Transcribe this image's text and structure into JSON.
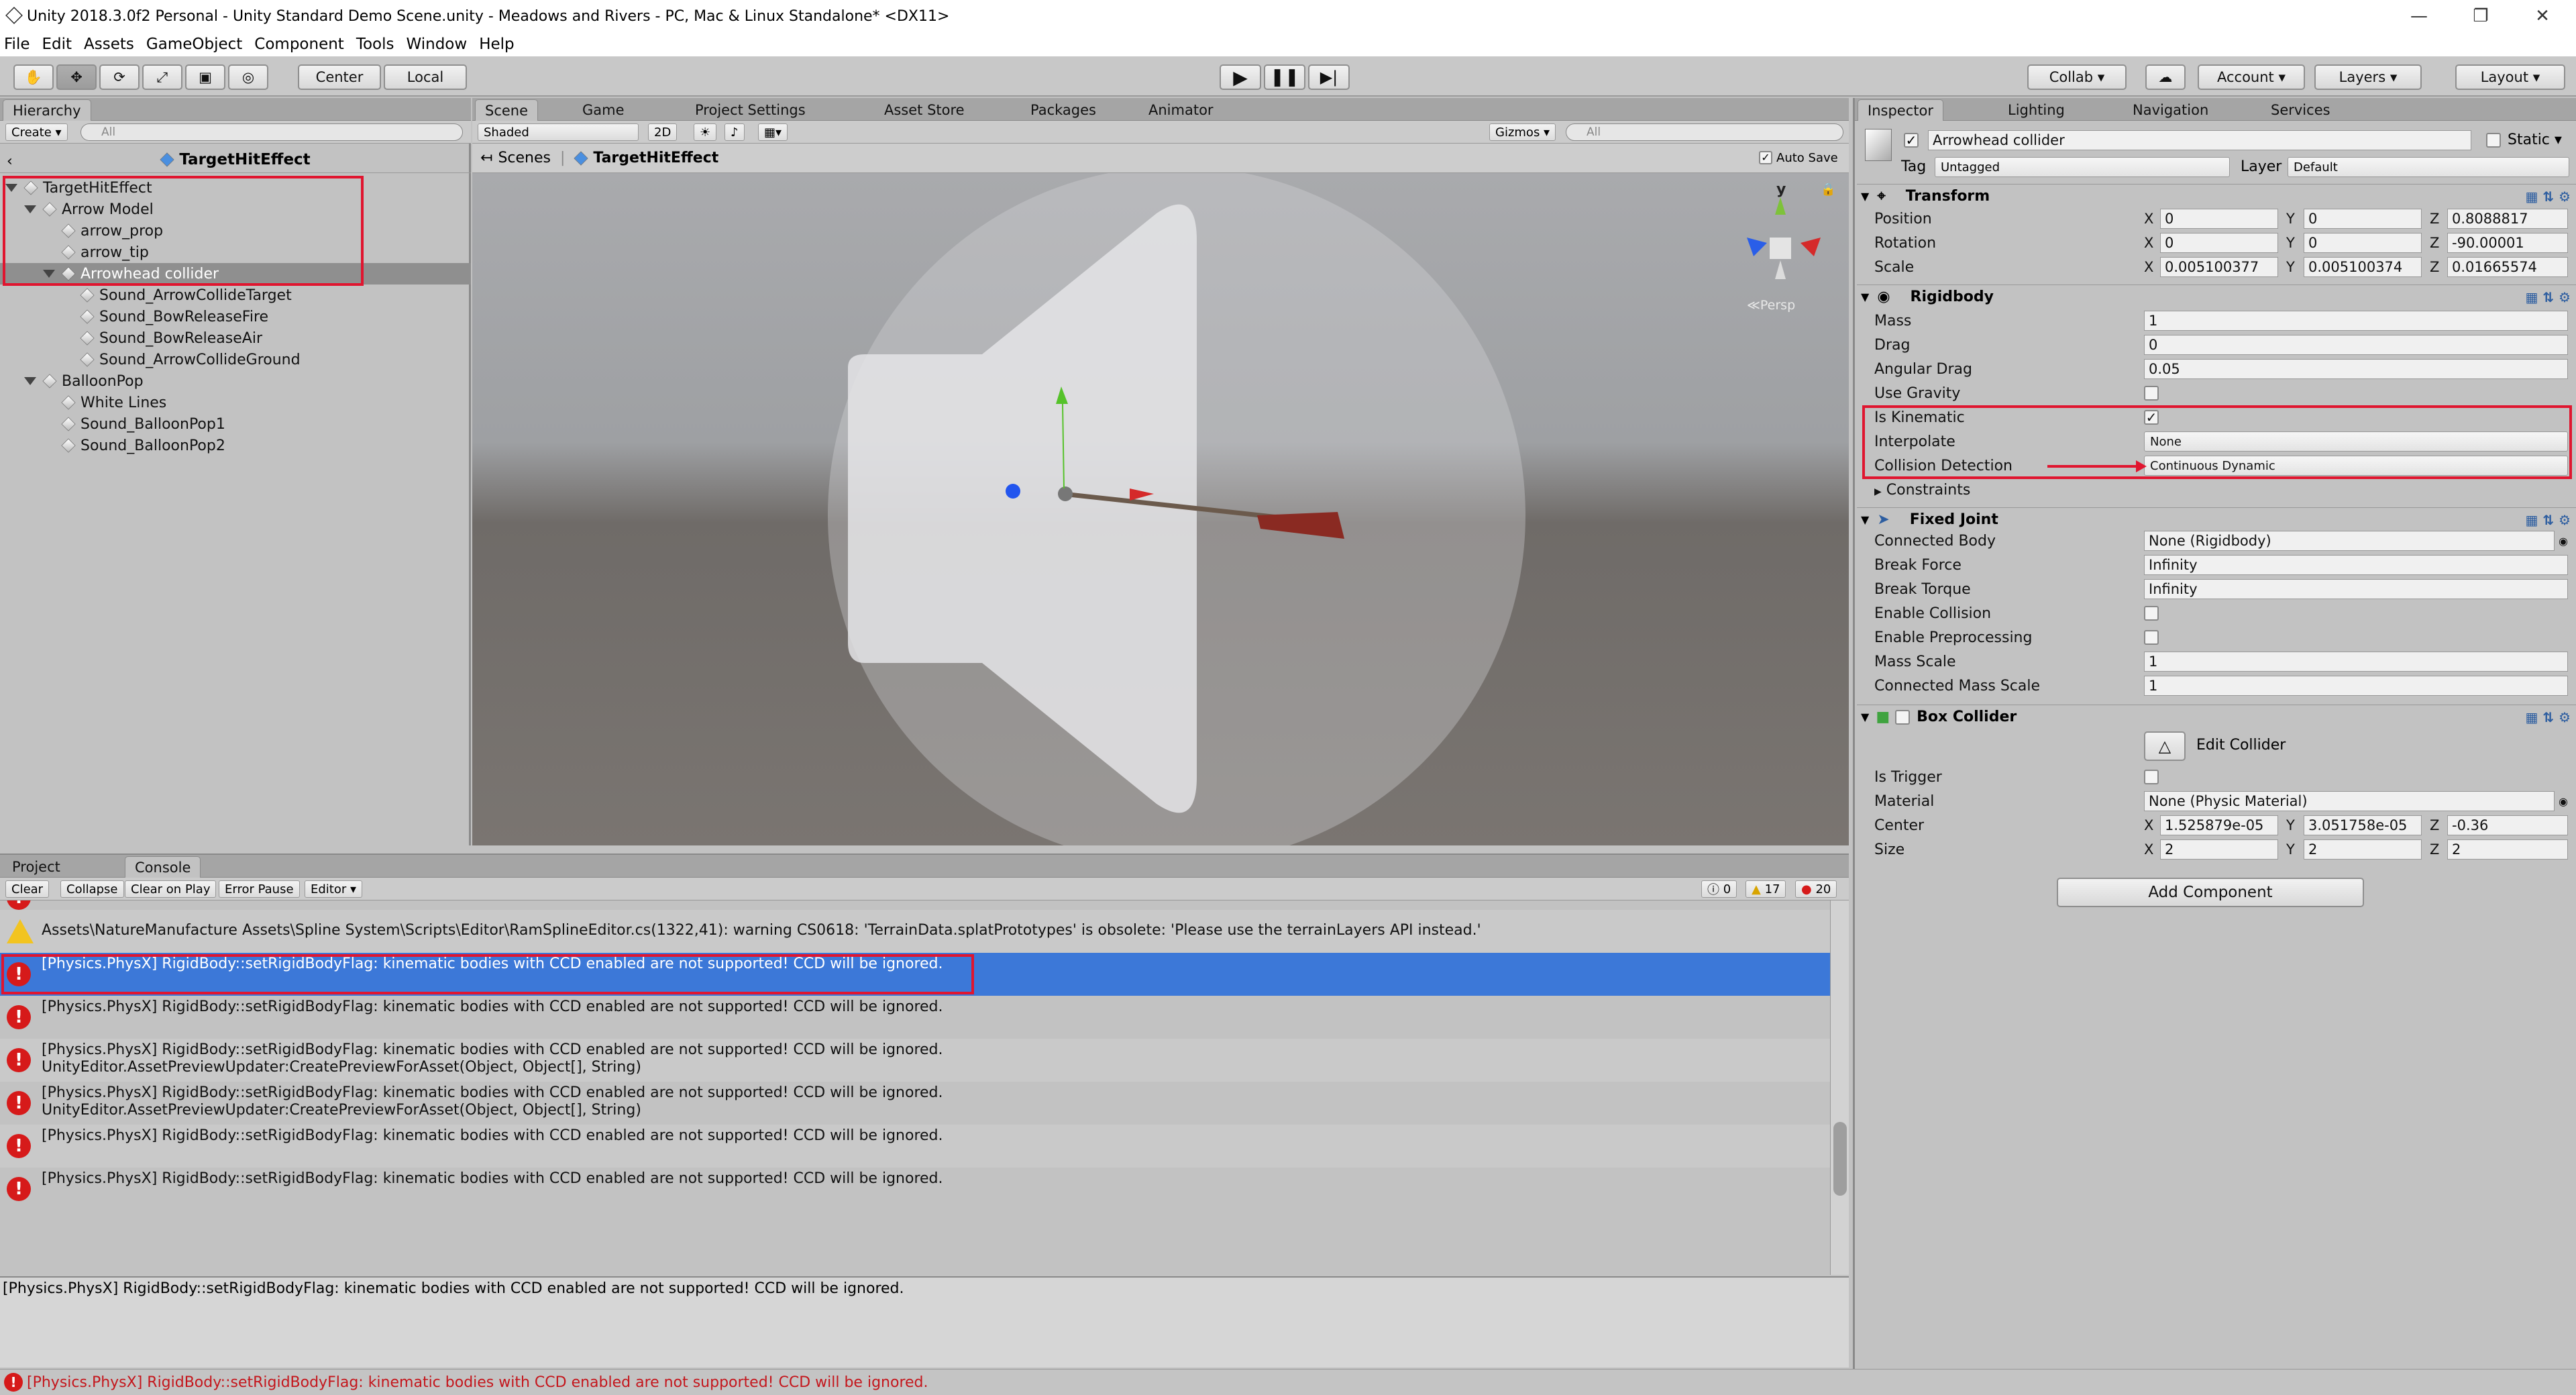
{
  "window": {
    "title": "Unity 2018.3.0f2 Personal - Unity Standard Demo Scene.unity - Meadows and Rivers - PC, Mac & Linux Standalone* <DX11>"
  },
  "menu": [
    "File",
    "Edit",
    "Assets",
    "GameObject",
    "Component",
    "Tools",
    "Window",
    "Help"
  ],
  "toolbar": {
    "center_label": "Center",
    "local_label": "Local",
    "collab_label": "Collab",
    "account_label": "Account",
    "layers_label": "Layers",
    "layout_label": "Layout"
  },
  "hierarchy": {
    "tab": "Hierarchy",
    "create_label": "Create",
    "search_placeholder": "All",
    "scene_title": "TargetHitEffect",
    "items": [
      {
        "label": "TargetHitEffect"
      },
      {
        "label": "Arrow Model"
      },
      {
        "label": "arrow_prop"
      },
      {
        "label": "arrow_tip"
      },
      {
        "label": "Arrowhead collider"
      },
      {
        "label": "Sound_ArrowCollideTarget"
      },
      {
        "label": "Sound_BowReleaseFire"
      },
      {
        "label": "Sound_BowReleaseAir"
      },
      {
        "label": "Sound_ArrowCollideGround"
      },
      {
        "label": "BalloonPop"
      },
      {
        "label": "White Lines"
      },
      {
        "label": "Sound_BalloonPop1"
      },
      {
        "label": "Sound_BalloonPop2"
      }
    ]
  },
  "scene": {
    "tabs": [
      "Scene",
      "Game",
      "Project Settings",
      "Asset Store",
      "Packages",
      "Animator"
    ],
    "shading": "Shaded",
    "mode_2d": "2D",
    "gizmos_label": "Gizmos",
    "search_placeholder": "All",
    "breadcrumb_root": "Scenes",
    "breadcrumb_current": "TargetHitEffect",
    "autosave_label": "Auto Save",
    "gizmo_axis_y": "y",
    "persp_label": "Persp"
  },
  "inspector": {
    "tabs": [
      "Inspector",
      "Lighting",
      "Navigation",
      "Services"
    ],
    "object_name": "Arrowhead collider",
    "static_label": "Static",
    "tag_label": "Tag",
    "tag_value": "Untagged",
    "layer_label": "Layer",
    "layer_value": "Default",
    "transform": {
      "title": "Transform",
      "position_label": "Position",
      "position": [
        "0",
        "0",
        "0.8088817"
      ],
      "rotation_label": "Rotation",
      "rotation": [
        "0",
        "0",
        "-90.00001"
      ],
      "scale_label": "Scale",
      "scale": [
        "0.005100377",
        "0.005100374",
        "0.01665574"
      ]
    },
    "axes": [
      "X",
      "Y",
      "Z"
    ],
    "rigidbody": {
      "title": "Rigidbody",
      "mass_label": "Mass",
      "mass": "1",
      "drag_label": "Drag",
      "drag": "0",
      "angular_drag_label": "Angular Drag",
      "angular_drag": "0.05",
      "use_gravity_label": "Use Gravity",
      "is_kinematic_label": "Is Kinematic",
      "interpolate_label": "Interpolate",
      "interpolate": "None",
      "collision_label": "Collision Detection",
      "collision": "Continuous Dynamic",
      "constraints_label": "Constraints"
    },
    "fixed_joint": {
      "title": "Fixed Joint",
      "connected_body_label": "Connected Body",
      "connected_body": "None (Rigidbody)",
      "break_force_label": "Break Force",
      "break_force": "Infinity",
      "break_torque_label": "Break Torque",
      "break_torque": "Infinity",
      "enable_collision_label": "Enable Collision",
      "enable_preprocessing_label": "Enable Preprocessing",
      "mass_scale_label": "Mass Scale",
      "mass_scale": "1",
      "connected_mass_scale_label": "Connected Mass Scale",
      "connected_mass_scale": "1"
    },
    "box_collider": {
      "title": "Box Collider",
      "edit_label": "Edit Collider",
      "is_trigger_label": "Is Trigger",
      "material_label": "Material",
      "material": "None (Physic Material)",
      "center_label": "Center",
      "center": [
        "1.525879e-05",
        "3.051758e-05",
        "-0.36"
      ],
      "size_label": "Size",
      "size": [
        "2",
        "2",
        "2"
      ]
    },
    "add_component_label": "Add Component"
  },
  "console": {
    "tabs": [
      "Project",
      "Console"
    ],
    "buttons": [
      "Clear",
      "Collapse",
      "Clear on Play",
      "Error Pause",
      "Editor"
    ],
    "count_info": "0",
    "count_warn": "17",
    "count_error": "20",
    "rows": [
      {
        "text": "Assets\\NatureManufacture Assets\\Spline System\\Scripts\\Editor\\RamSplineEditor.cs(1322,41): warning CS0618: 'TerrainData.splatPrototypes' is obsolete: 'Please use the terrainLayers API instead.'"
      },
      {
        "text": "[Physics.PhysX] RigidBody::setRigidBodyFlag: kinematic bodies with CCD enabled are not supported! CCD will be ignored."
      },
      {
        "text": "[Physics.PhysX] RigidBody::setRigidBodyFlag: kinematic bodies with CCD enabled are not supported! CCD will be ignored."
      },
      {
        "text": "[Physics.PhysX] RigidBody::setRigidBodyFlag: kinematic bodies with CCD enabled are not supported! CCD will be ignored.\nUnityEditor.AssetPreviewUpdater:CreatePreviewForAsset(Object, Object[], String)"
      },
      {
        "text": "[Physics.PhysX] RigidBody::setRigidBodyFlag: kinematic bodies with CCD enabled are not supported! CCD will be ignored.\nUnityEditor.AssetPreviewUpdater:CreatePreviewForAsset(Object, Object[], String)"
      },
      {
        "text": "[Physics.PhysX] RigidBody::setRigidBodyFlag: kinematic bodies with CCD enabled are not supported! CCD will be ignored."
      },
      {
        "text": "[Physics.PhysX] RigidBody::setRigidBodyFlag: kinematic bodies with CCD enabled are not supported! CCD will be ignored."
      }
    ],
    "detail": "[Physics.PhysX] RigidBody::setRigidBodyFlag: kinematic bodies with CCD enabled are not supported! CCD will be ignored."
  },
  "status": {
    "text": "[Physics.PhysX] RigidBody::setRigidBodyFlag: kinematic bodies with CCD enabled are not supported! CCD will be ignored."
  },
  "colors": {
    "highlight": "#e0152f",
    "selection": "#3c78d8"
  }
}
